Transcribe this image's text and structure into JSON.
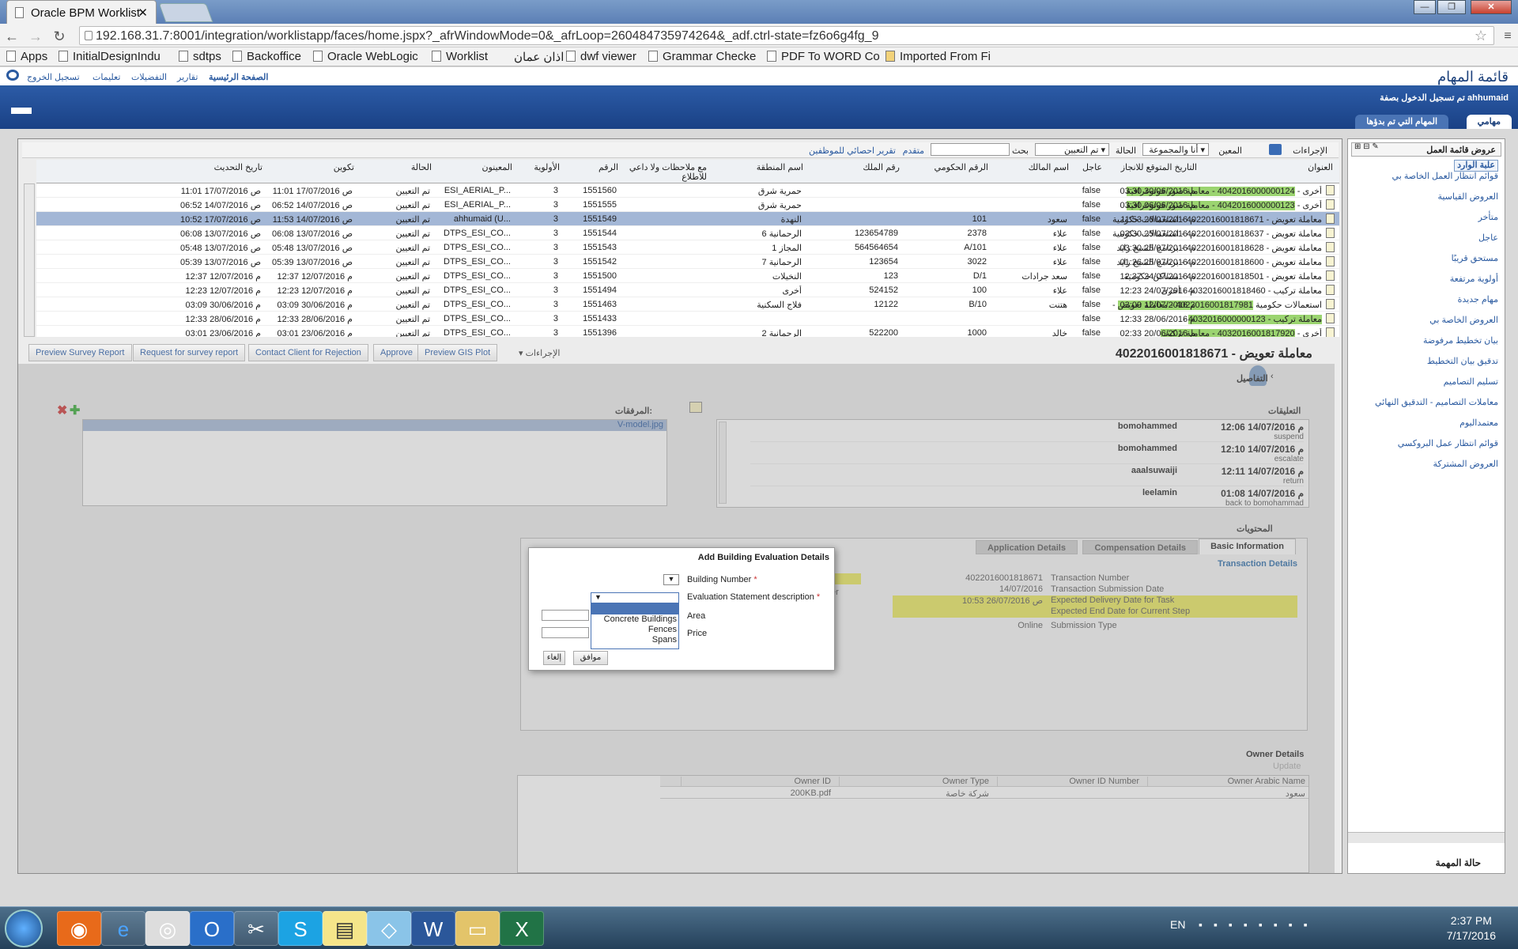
{
  "browser": {
    "tab_title": "Oracle BPM Worklist",
    "url": "192.168.31.7:8001/integration/worklistapp/faces/home.jspx?_afrWindowMode=0&_afrLoop=260484735974264&_adf.ctrl-state=fz6o6g4fg_9",
    "bookmarks": [
      "Apps",
      "InitialDesignIndu",
      "sdtps",
      "Backoffice",
      "Oracle WebLogic",
      "Worklist",
      "اذان عمان",
      "dwf viewer",
      "Grammar Checke",
      "PDF To WORD Co",
      "Imported From Fi"
    ]
  },
  "app": {
    "title": "قائمة المهام",
    "links": {
      "home": "الصفحة الرئيسية",
      "reports": "تقارير",
      "preferences": "التفضيلات",
      "help": "تعليمات",
      "logout": "تسجيل الخروج"
    },
    "login_text": "تم تسجيل الدخول بصفة ahhumaid",
    "tab_my_tasks": "مهامي",
    "tab_started": "المهام التي تم بدؤها"
  },
  "left_panel": {
    "title": "عروض قائمة العمل",
    "items": [
      "علبة الوارد",
      "قوائم انتظار العمل الخاصة بي",
      "العروض القياسية",
      "متأخر",
      "عاجل",
      "مستحق قريبًا",
      "أولوية مرتفعة",
      "مهام جديدة",
      "العروض الخاصة بي",
      "بيان تخطيط مرفوضة",
      "تدقيق بيان التخطيط",
      "تسليم التصاميم",
      "معاملات التصاميم - التدقيق النهائي",
      "معتمداليوم",
      "قوائم انتظار عمل البروكسي",
      "العروض المشتركة"
    ],
    "footer": "حالة المهمة"
  },
  "worklist": {
    "toolbar": {
      "actions": "الإجراءات",
      "assignee_label": "المعين",
      "assignee_value": "أنا والمجموعة",
      "status_label": "الحالة",
      "status_value": "تم التعيين",
      "search_label": "بحث",
      "advanced": "متقدم",
      "report": "تقرير احصائي للموظفين"
    },
    "columns": [
      "العنوان",
      "التاريخ المتوقع للانجاز",
      "عاجل",
      "اسم المالك",
      "الرقم الحكومي",
      "رقم الملك",
      "اسم المنطقة",
      "مع ملاحظات ولا داعي للاطلاع",
      "الرقم",
      "الأولوية",
      "المعينون",
      "الحالة",
      "تكوين",
      "تاريخ التحديث"
    ],
    "rows": [
      {
        "title_hl": "4042016000000124 - معاملة صور فوتوغرافية",
        "title_rest": "أخرى -",
        "due": "03:30 م 30/06/2016",
        "urgent": "false",
        "owner": "",
        "gov": "",
        "plot": "",
        "area": "حمرية شرق",
        "num": "1551560",
        "prio": "3",
        "assignees": "ESI_AERIAL_P...",
        "status": "تم التعيين",
        "created": "11:01 ص 17/07/2016",
        "updated": "11:01 ص 17/07/2016"
      },
      {
        "title_hl": "4042016000000123 - معاملة صور فوتوغرافية",
        "title_rest": "أخرى -",
        "due": "03:30 م 06/06/2016",
        "urgent": "false",
        "owner": "",
        "gov": "",
        "plot": "",
        "area": "حمرية شرق",
        "num": "1551555",
        "prio": "3",
        "assignees": "ESI_AERIAL_P...",
        "status": "تم التعيين",
        "created": "06:52 ص 14/07/2016",
        "updated": "06:52 ص 14/07/2016"
      },
      {
        "title_hl": "",
        "title_rest": "معاملة تعويض - 4022016001818671 - استعمالات حكومية",
        "due": "11:53 م 26/07/2016",
        "urgent": "false",
        "owner": "سعود",
        "gov": "101",
        "plot": "",
        "area": "النهدة",
        "num": "1551549",
        "prio": "3",
        "assignees": "ahhumaid (U...",
        "status": "تم التعيين",
        "created": "11:53 ص 14/07/2016",
        "updated": "10:52 ص 17/07/2016",
        "selected": true
      },
      {
        "title_hl": "",
        "title_rest": "معاملة تعويض - 4022016001818637 - استعمالات حكومية",
        "due": "03:30 م 25/07/2016",
        "urgent": "false",
        "owner": "علاء",
        "gov": "2378",
        "plot": "123654789",
        "area": "الرحمانية 6",
        "num": "1551544",
        "prio": "3",
        "assignees": "DTPS_ESI_CO...",
        "status": "تم التعيين",
        "created": "06:08 ص 13/07/2016",
        "updated": "06:08 ص 13/07/2016"
      },
      {
        "title_hl": "",
        "title_rest": "معاملة تعويض - 4022016001818628 - برنامج الشيخ زايد",
        "due": "03:30 م 25/07/2016",
        "urgent": "false",
        "owner": "علاء",
        "gov": "A/101",
        "plot": "564564654",
        "area": "المجاز 1",
        "num": "1551543",
        "prio": "3",
        "assignees": "DTPS_ESI_CO...",
        "status": "تم التعيين",
        "created": "05:48 ص 13/07/2016",
        "updated": "05:48 ص 13/07/2016"
      },
      {
        "title_hl": "",
        "title_rest": "معاملة تعويض - 4022016001818600 - برنامج الشيخ زايد",
        "due": "01:26 م 25/07/2016",
        "urgent": "false",
        "owner": "علاء",
        "gov": "3022",
        "plot": "123654",
        "area": "الرحمانية 7",
        "num": "1551542",
        "prio": "3",
        "assignees": "DTPS_ESI_CO...",
        "status": "تم التعيين",
        "created": "05:39 ص 13/07/2016",
        "updated": "05:39 ص 13/07/2016"
      },
      {
        "title_hl": "",
        "title_rest": "معاملة تعويض - 4022016001818501 - مساكن حكومية",
        "due": "12:37 م 24/07/2016",
        "urgent": "false",
        "owner": "سعد جرادات",
        "gov": "D/1",
        "plot": "123",
        "area": "النخيلات",
        "num": "1551500",
        "prio": "3",
        "assignees": "DTPS_ESI_CO...",
        "status": "تم التعيين",
        "created": "12:37 م 12/07/2016",
        "updated": "12:37 م 12/07/2016"
      },
      {
        "title_hl": "",
        "title_rest": "معاملة تركيب - 4032016001818460 - أخرى",
        "due": "12:23 م 24/07/2016",
        "urgent": "false",
        "owner": "علاء",
        "gov": "100",
        "plot": "524152",
        "area": "أخرى",
        "num": "1551494",
        "prio": "3",
        "assignees": "DTPS_ESI_CO...",
        "status": "تم التعيين",
        "created": "12:23 م 12/07/2016",
        "updated": "12:23 م 12/07/2016"
      },
      {
        "title_hl": "4022016001817981 - معاملة تعويض",
        "title_rest": "- استعمالات حكومية",
        "due": "03:09 م 12/07/2016",
        "urgent": "false",
        "owner": "هتنت",
        "gov": "B/10",
        "plot": "12122",
        "area": "فلاج السكنية",
        "num": "1551463",
        "prio": "3",
        "assignees": "DTPS_ESI_CO...",
        "status": "تم التعيين",
        "created": "03:09 م 30/06/2016",
        "updated": "03:09 م 30/06/2016"
      },
      {
        "title_hl": "4032016000000123 - معاملة تركيب",
        "title_rest": "-",
        "due": "12:33 م 28/06/2016",
        "urgent": "false",
        "owner": "",
        "gov": "",
        "plot": "",
        "area": "",
        "num": "1551433",
        "prio": "3",
        "assignees": "DTPS_ESI_CO...",
        "status": "تم التعيين",
        "created": "12:33 م 28/06/2016",
        "updated": "12:33 م 28/06/2016"
      },
      {
        "title_hl": "4032016001817920 - معاملة تركيب",
        "title_rest": "أخرى -",
        "due": "02:33 م 20/06/2016",
        "urgent": "false",
        "owner": "خالد",
        "gov": "1000",
        "plot": "522200",
        "area": "الرحمانية 2",
        "num": "1551396",
        "prio": "3",
        "assignees": "DTPS_ESI_CO...",
        "status": "تم التعيين",
        "created": "03:01 م 23/06/2016",
        "updated": "03:01 م 23/06/2016"
      }
    ]
  },
  "actions": {
    "preview_survey": "Preview Survey Report",
    "request_survey": "Request for survey report",
    "contact_client": "Contact Client for Rejection",
    "approve": "Approve",
    "preview_gis": "Preview GIS Plot",
    "more": "الإجراءات"
  },
  "task": {
    "title": "معاملة تعويض - 4022016001818671",
    "details_label": "التفاصيل",
    "comments_label": "التعليقات",
    "attachments_label": "المرفقات:",
    "attachment_file": "V-model.jpg",
    "comments": [
      {
        "user": "bomohammed",
        "date": "12:06 م 14/07/2016",
        "action": "suspend"
      },
      {
        "user": "bomohammed",
        "date": "12:10 م 14/07/2016",
        "action": "escalate"
      },
      {
        "user": "aaalsuwaiji",
        "date": "12:11 م 14/07/2016",
        "action": "return"
      },
      {
        "user": "leelamin",
        "date": "01:08 م 14/07/2016",
        "action": "back to bomohammad"
      }
    ],
    "contents_label": "المحتويات",
    "subtabs": {
      "basic": "Basic Information",
      "comp": "Compensation Details",
      "app": "Application Details"
    },
    "txn_header": "Transaction Details",
    "txn_fields": [
      {
        "label": "Transaction Number",
        "value": "4022016001818671"
      },
      {
        "label": "Transaction Submission Date",
        "value": "14/07/2016"
      },
      {
        "label": "Expected Delivery Date for Task",
        "value": "10:53 ص 26/07/2016"
      },
      {
        "label": "Expected End Date for Current Step",
        "value": ""
      },
      {
        "label": "Submission Type",
        "value": "Online"
      }
    ],
    "er_fragment": "er",
    "owner_header": "Owner Details",
    "owner_update": "Update",
    "owner_cols": [
      "Owner Arabic Name",
      "Owner ID Number",
      "Owner Type",
      "Owner ID"
    ],
    "owner_row": [
      "سعود",
      "",
      "شركة خاصة",
      "200KB.pdf"
    ]
  },
  "modal": {
    "title": "Add Building Evaluation Details",
    "building_number": "Building Number",
    "eval_desc": "Evaluation Statement description",
    "area": "Area",
    "price": "Price",
    "required_mark": "*",
    "options": [
      "",
      "Concrete Buildings",
      "Fences",
      "Spans"
    ],
    "ok": "موافق",
    "cancel": "إلغاء"
  },
  "taskbar": {
    "lang": "EN",
    "time": "2:37 PM",
    "date": "7/17/2016"
  },
  "colors": {
    "accent": "#2a5aa0",
    "highlight": "#9bd470",
    "selected": "#a3b7d6",
    "yellow": "#e9e65a"
  }
}
